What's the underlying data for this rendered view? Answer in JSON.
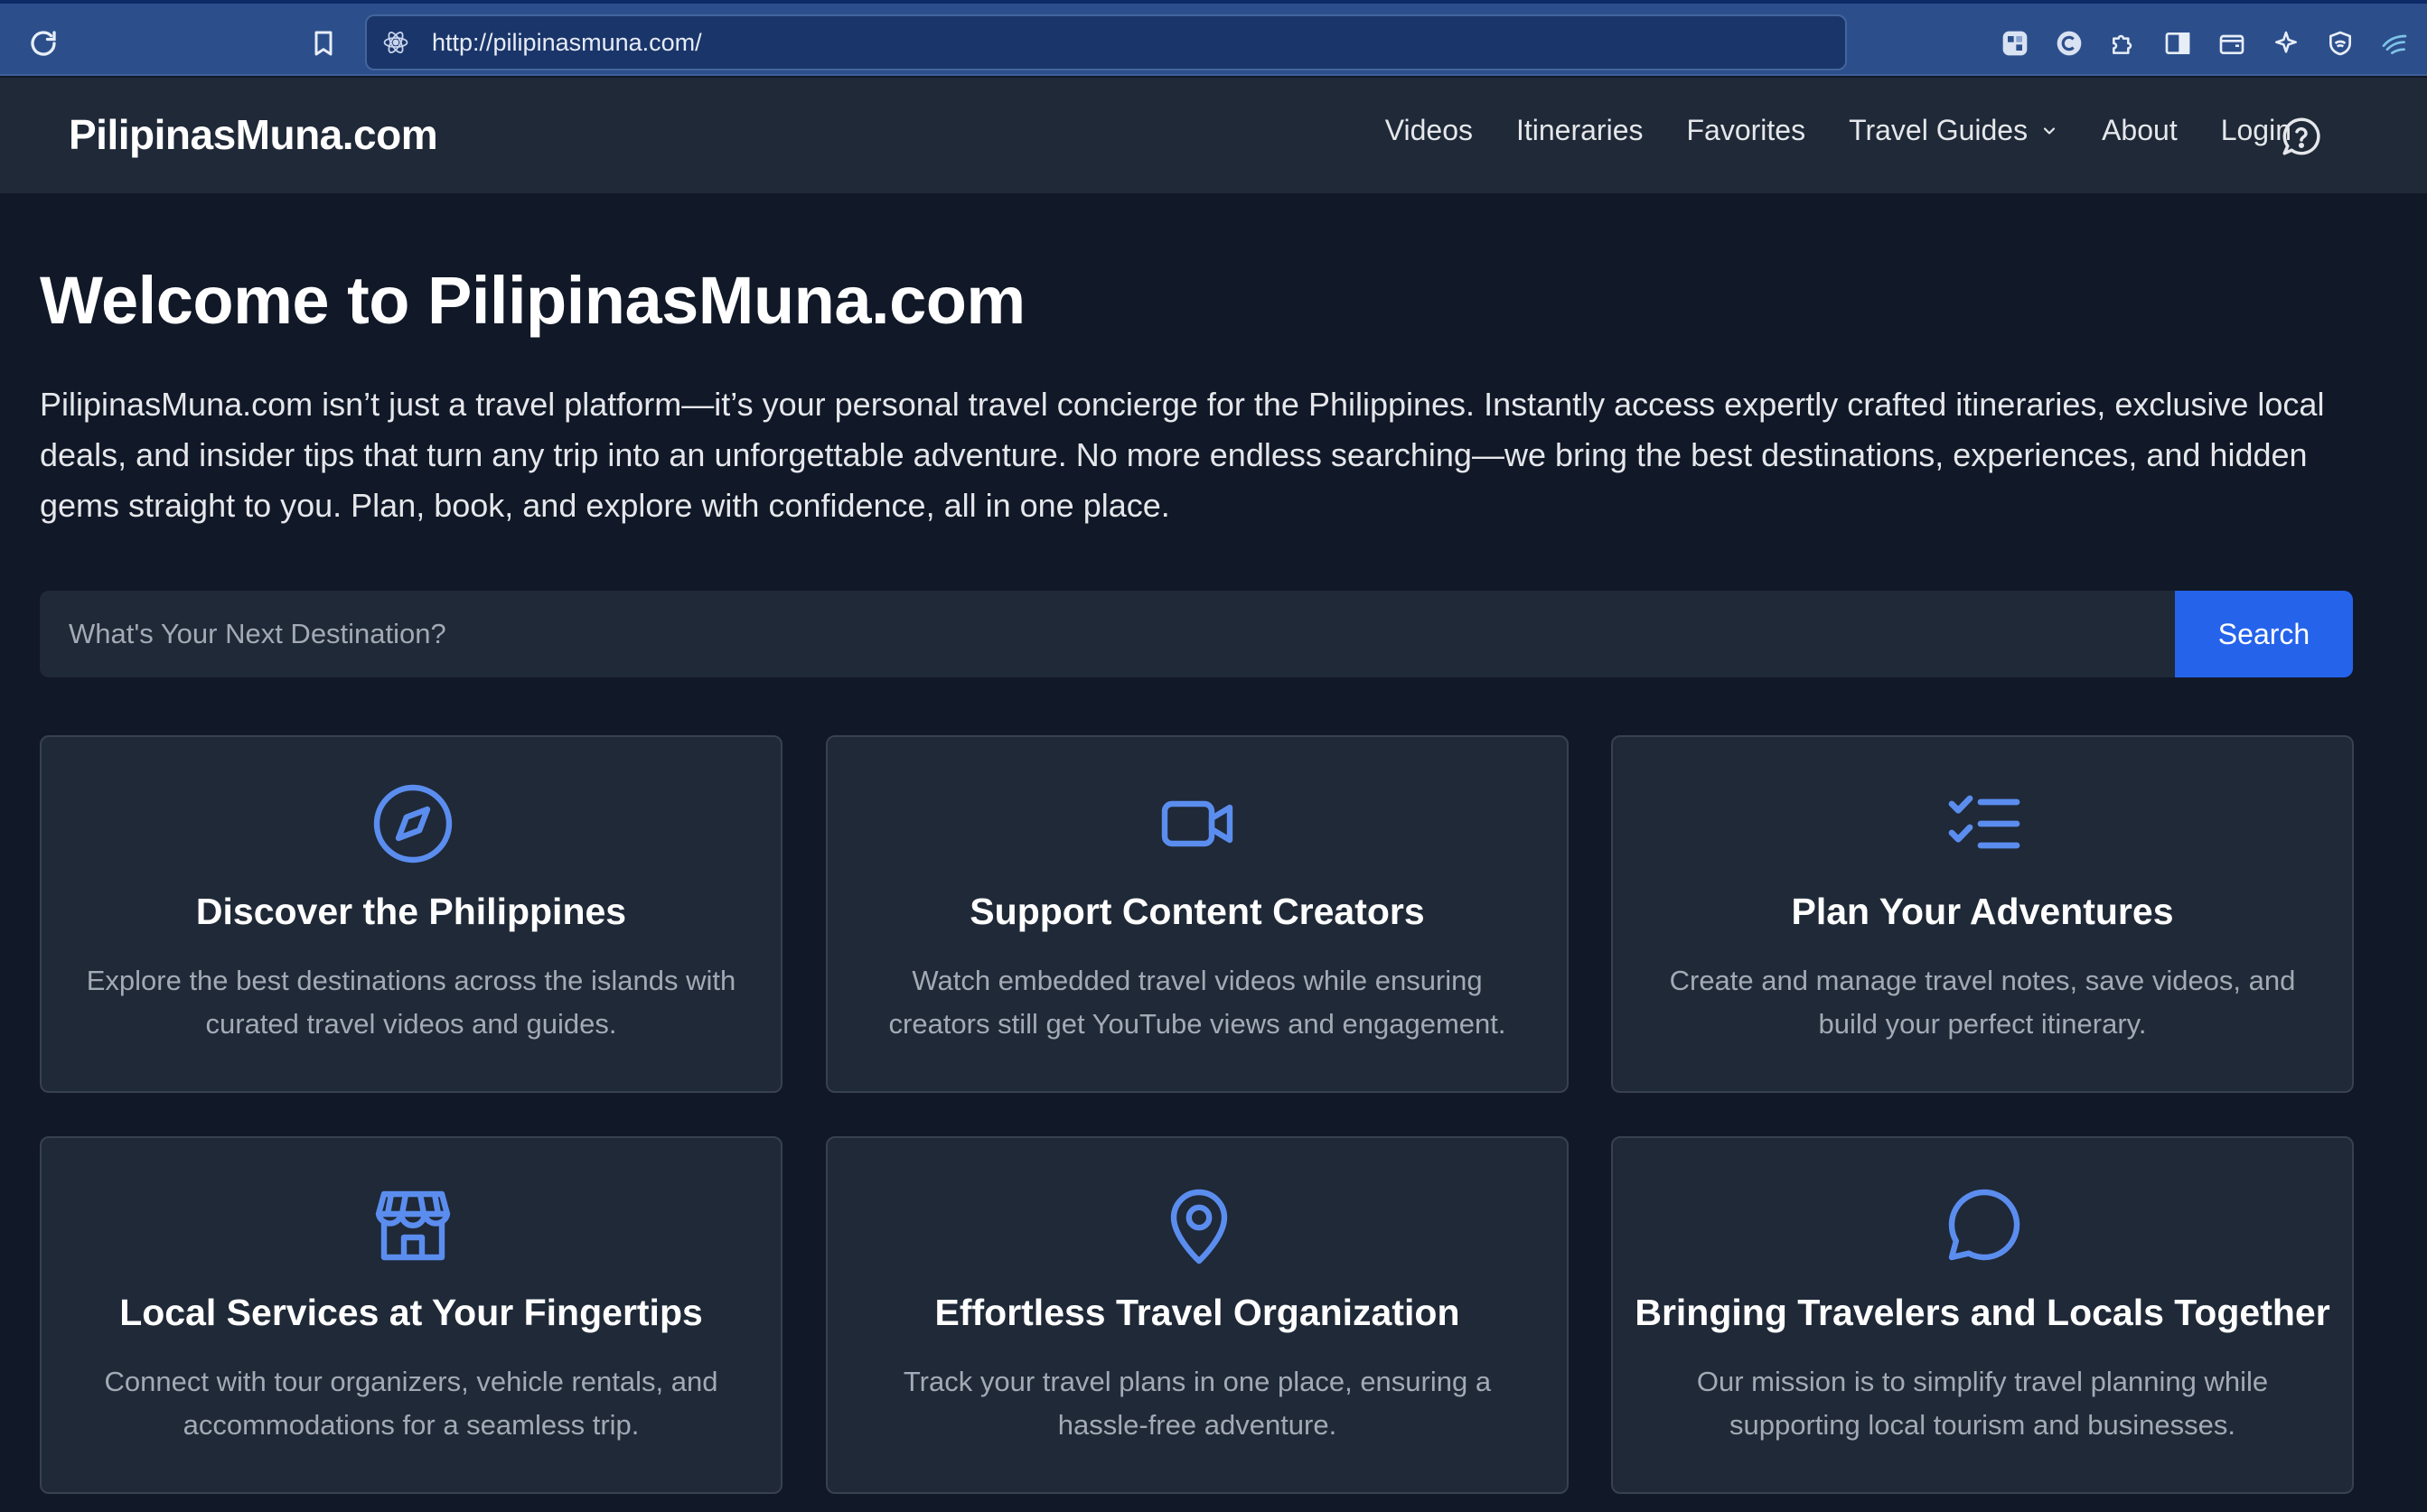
{
  "browser": {
    "url": "http://pilipinasmuna.com/",
    "icons": [
      "reload-icon",
      "bookmark-icon",
      "site-react-icon",
      "extension-grid-icon",
      "extension-c-icon",
      "puzzle-icon",
      "sidebar-icon",
      "wallet-icon",
      "sparkle-icon",
      "shield-icon",
      "wing-icon"
    ]
  },
  "header": {
    "brand": "PilipinasMuna.com",
    "nav": {
      "videos": "Videos",
      "itineraries": "Itineraries",
      "favorites": "Favorites",
      "travel_guides": "Travel Guides",
      "about": "About",
      "login": "Login"
    },
    "help_icon": "help-circle-icon"
  },
  "hero": {
    "title": "Welcome to PilipinasMuna.com",
    "description": "PilipinasMuna.com isn’t just a travel platform—it’s your personal travel concierge for the Philippines. Instantly access expertly crafted itineraries, exclusive local deals, and insider tips that turn any trip into an unforgettable adventure. No more endless searching—we bring the best destinations, experiences, and hidden gems straight to you. Plan, book, and explore with confidence, all in one place."
  },
  "search": {
    "placeholder": "What's Your Next Destination?",
    "value": "",
    "button": "Search"
  },
  "colors": {
    "page_bg": "#111827",
    "card_bg": "#1f2937",
    "accent": "#2563eb",
    "icon": "#5b8def",
    "browser_bar": "#2c4f8c"
  },
  "features": [
    {
      "icon": "compass-icon",
      "title": "Discover the Philippines",
      "description": "Explore the best destinations across the islands with curated travel videos and guides."
    },
    {
      "icon": "video-camera-icon",
      "title": "Support Content Creators",
      "description": "Watch embedded travel videos while ensuring creators still get YouTube views and engagement."
    },
    {
      "icon": "checklist-icon",
      "title": "Plan Your Adventures",
      "description": "Create and manage travel notes, save videos, and build your perfect itinerary."
    },
    {
      "icon": "storefront-icon",
      "title": "Local Services at Your Fingertips",
      "description": "Connect with tour organizers, vehicle rentals, and accommodations for a seamless trip."
    },
    {
      "icon": "map-pin-icon",
      "title": "Effortless Travel Organization",
      "description": "Track your travel plans in one place, ensuring a hassle-free adventure."
    },
    {
      "icon": "chat-bubble-icon",
      "title": "Bringing Travelers and Locals Together",
      "description": "Our mission is to simplify travel planning while supporting local tourism and businesses."
    }
  ]
}
